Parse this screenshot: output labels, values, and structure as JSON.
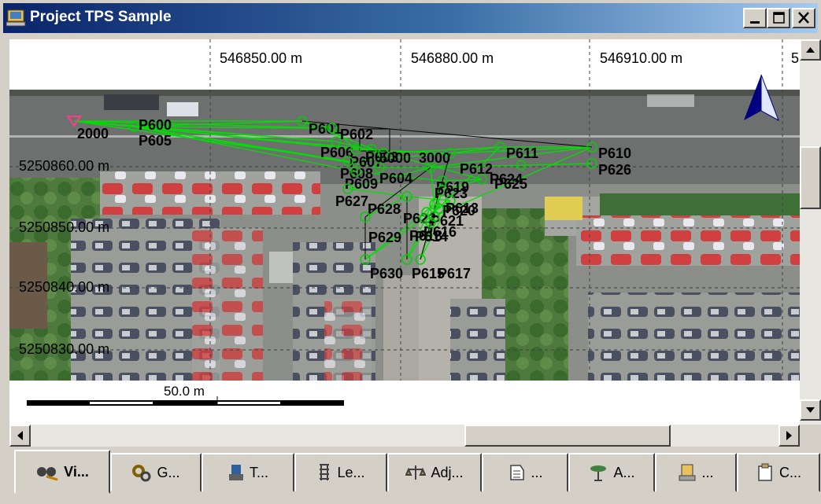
{
  "window": {
    "title": "Project TPS Sample"
  },
  "map": {
    "x_coords": [
      "546850.00 m",
      "546880.00 m",
      "546910.00 m",
      "5"
    ],
    "y_coords": [
      "5250860.00 m",
      "5250850.00 m",
      "5250840.00 m",
      "5250830.00 m"
    ],
    "scale_label": "50.0 m",
    "points": [
      {
        "label": "2000",
        "color": "#ff3c8c"
      },
      {
        "label": "P600"
      },
      {
        "label": "P605"
      },
      {
        "label": "P601"
      },
      {
        "label": "P602"
      },
      {
        "label": "P606"
      },
      {
        "label": "P607"
      },
      {
        "label": "P608"
      },
      {
        "label": "P609"
      },
      {
        "label": "P603"
      },
      {
        "label": "P604"
      },
      {
        "label": "5000"
      },
      {
        "label": "3000"
      },
      {
        "label": "P612"
      },
      {
        "label": "P611"
      },
      {
        "label": "P610"
      },
      {
        "label": "P626"
      },
      {
        "label": "P625"
      },
      {
        "label": "P619"
      },
      {
        "label": "P624"
      },
      {
        "label": "P623"
      },
      {
        "label": "P627"
      },
      {
        "label": "P628"
      },
      {
        "label": "P620"
      },
      {
        "label": "P622"
      },
      {
        "label": "P621"
      },
      {
        "label": "P616"
      },
      {
        "label": "P629"
      },
      {
        "label": "P618"
      },
      {
        "label": "P614"
      },
      {
        "label": "P613"
      },
      {
        "label": "P630"
      },
      {
        "label": "P615"
      },
      {
        "label": "P617"
      }
    ]
  },
  "tabs": [
    {
      "label": "Vi...",
      "icon": "view-icon"
    },
    {
      "label": "G...",
      "icon": "gear-icon"
    },
    {
      "label": "T...",
      "icon": "instrument-icon"
    },
    {
      "label": "Le...",
      "icon": "level-icon"
    },
    {
      "label": "Adj...",
      "icon": "scale-icon"
    },
    {
      "label": "...",
      "icon": "document-icon"
    },
    {
      "label": "A...",
      "icon": "analysis-icon"
    },
    {
      "label": "...",
      "icon": "report-icon"
    },
    {
      "label": "C...",
      "icon": "clipboard-icon"
    }
  ],
  "colors": {
    "title_start": "#0a246a",
    "title_end": "#a6caf0",
    "network": "#00ff00",
    "labels": "#000000"
  }
}
